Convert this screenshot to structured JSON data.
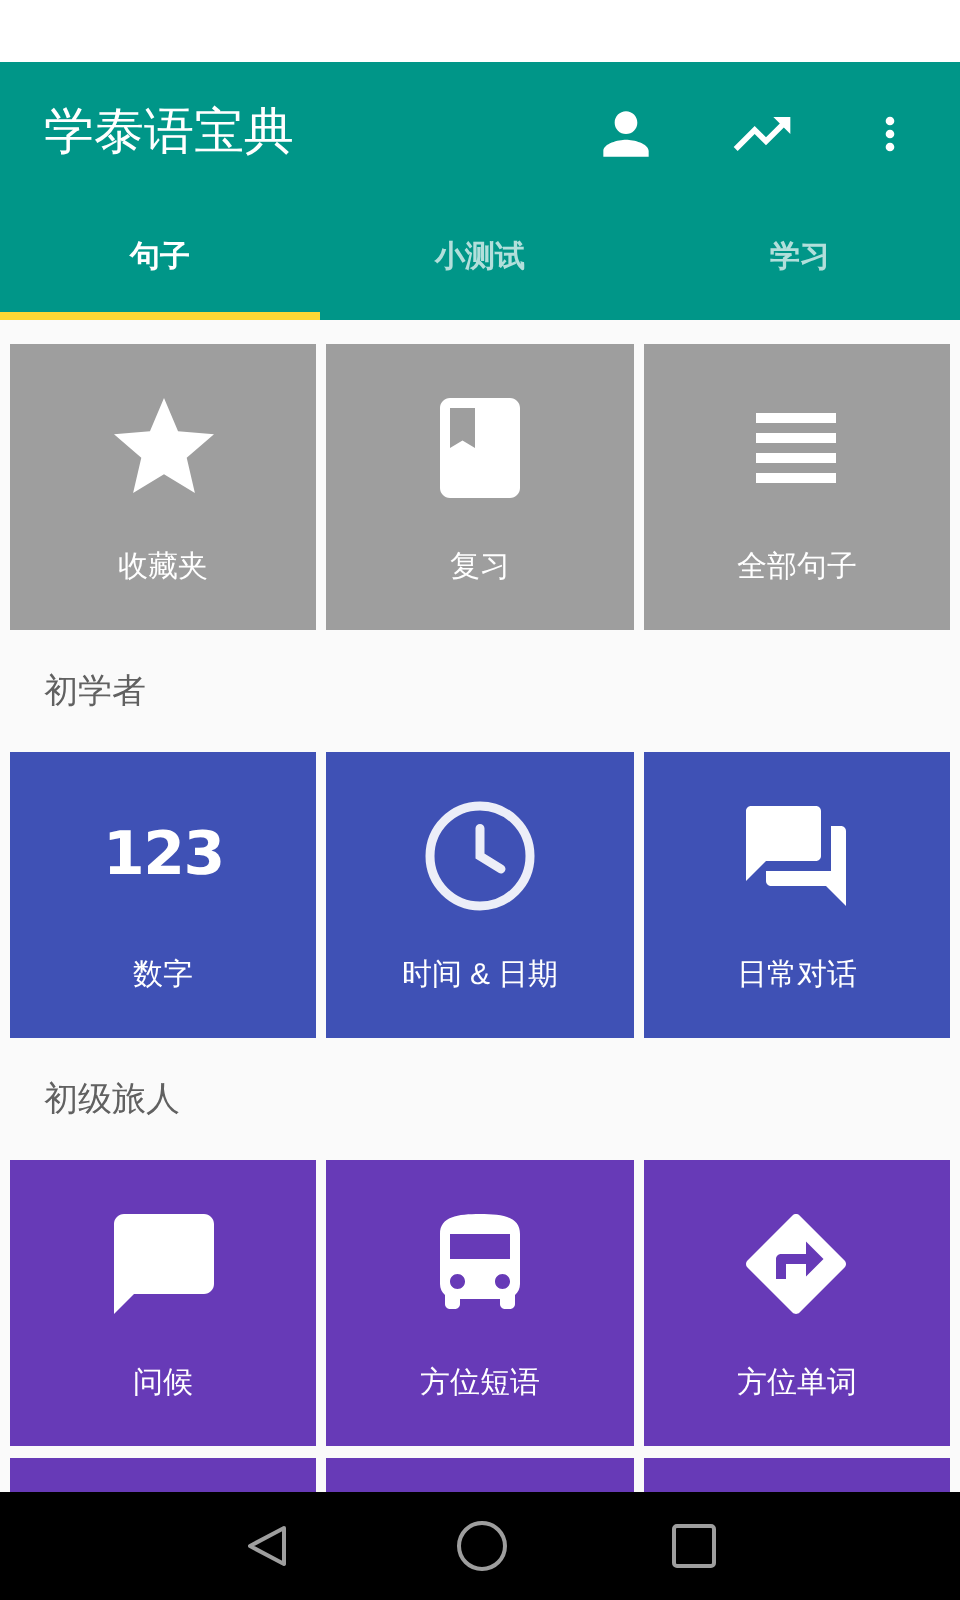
{
  "app_bar": {
    "title": "学泰语宝典",
    "actions": [
      {
        "kind": "person"
      },
      {
        "kind": "trending"
      },
      {
        "kind": "more"
      }
    ]
  },
  "tabs": [
    {
      "label": "句子",
      "selected": true
    },
    {
      "label": "小测试",
      "selected": false
    },
    {
      "label": "学习",
      "selected": false
    }
  ],
  "sections": [
    {
      "color": "#9e9e9e",
      "tiles": [
        {
          "kind": "star",
          "label": "收藏夹"
        },
        {
          "kind": "book",
          "label": "复习"
        },
        {
          "kind": "lines",
          "label": "全部句子"
        }
      ]
    },
    {
      "title": "初学者",
      "color": "#3f51b5",
      "tiles": [
        {
          "kind": "digits",
          "icon_text": "123",
          "label": "数字"
        },
        {
          "kind": "clock",
          "label": "时间 & 日期"
        },
        {
          "kind": "forum",
          "label": "日常对话"
        }
      ]
    },
    {
      "title": "初级旅人",
      "color": "#673ab7",
      "tiles": [
        {
          "kind": "bubble",
          "label": "问候"
        },
        {
          "kind": "bus",
          "label": "方位短语"
        },
        {
          "kind": "directions",
          "label": "方位单词"
        },
        {
          "kind": "blank"
        },
        {
          "kind": "blank"
        },
        {
          "kind": "blank"
        }
      ]
    }
  ],
  "nav_bar": [
    {
      "kind": "back"
    },
    {
      "kind": "home"
    },
    {
      "kind": "recents"
    }
  ]
}
